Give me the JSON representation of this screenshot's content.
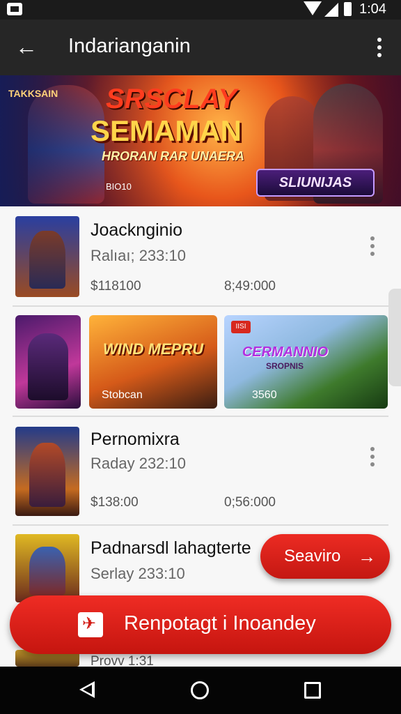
{
  "status_bar": {
    "time": "1:04"
  },
  "app_bar": {
    "title": "Indarianganin"
  },
  "banner": {
    "top_tag": "TAKKSAIN",
    "line1": "SRSCLAY",
    "line2": "SEMAMAN",
    "line3": "HRORAN RAR UNAERA",
    "code": "BIO10",
    "brand": "SLIUNIJAS"
  },
  "list": {
    "rows": [
      {
        "name": "Joacknginio",
        "sub": "Ralıaı; 233:10",
        "price_a": "$118100",
        "price_b": "8;49:000"
      },
      {
        "name": "Pernomixra",
        "sub": "Raday 232:10",
        "price_a": "$138:00",
        "price_b": "0;56:000"
      },
      {
        "name": "Padnarsdl lahagterte",
        "sub": "Serlay 233:10",
        "price_a": "Provv 1:31",
        "price_b": ""
      }
    ],
    "tiles": [
      {
        "title": ""
      },
      {
        "title": "WIND MEPRU",
        "foot": "Stobcan"
      },
      {
        "title": "CERMANNIO",
        "subtitle": "SROPNIS",
        "foot": "3560",
        "badge": "IISI"
      }
    ]
  },
  "floating_button": {
    "label": "Seaviro",
    "icon": "arrow-right-icon"
  },
  "cta": {
    "label": "Renpotagt i Inoandey",
    "icon": "plane-icon"
  },
  "colors": {
    "accent": "#d8201a",
    "app_bar": "#262626",
    "status_bar": "#1b1b1b"
  }
}
